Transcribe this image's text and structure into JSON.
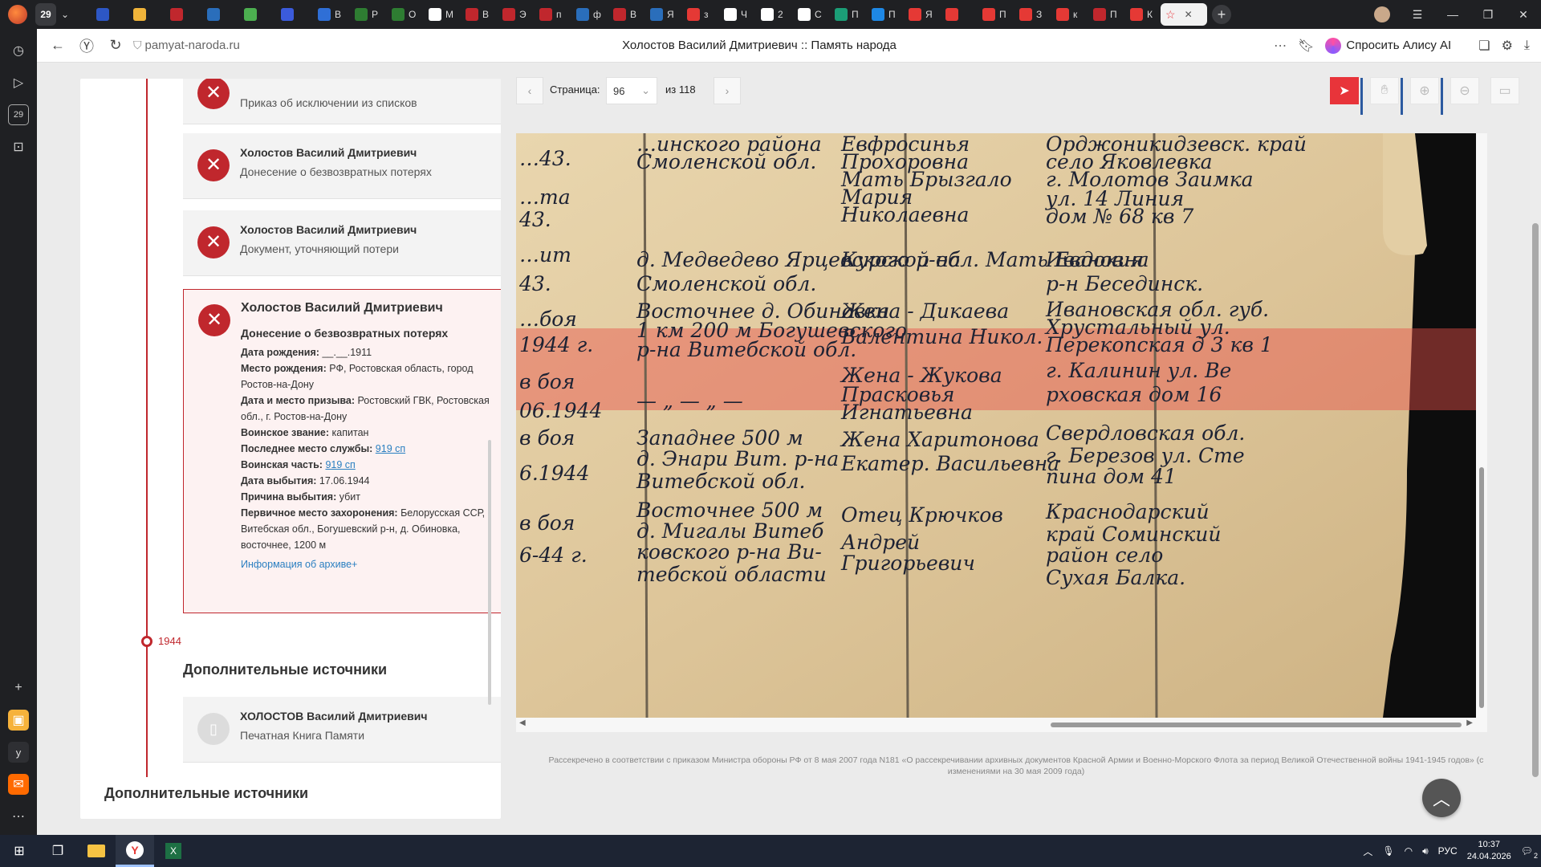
{
  "browser": {
    "tab_count": "29",
    "tabs": [
      {
        "label": "",
        "color": "#2d57c5"
      },
      {
        "label": "",
        "color": "#f0b43a"
      },
      {
        "label": "",
        "color": "#c0272d"
      },
      {
        "label": "",
        "color": "#2a6ebb"
      },
      {
        "label": "",
        "color": "#4caf50"
      },
      {
        "label": "",
        "color": "#3b5bdb"
      },
      {
        "label": "В",
        "color": "#2f6fd6"
      },
      {
        "label": "P",
        "color": "#2e7d32"
      },
      {
        "label": "O",
        "color": "#2e7d32"
      },
      {
        "label": "M",
        "color": "#ffffff"
      },
      {
        "label": "B",
        "color": "#c0272d"
      },
      {
        "label": "Э",
        "color": "#c0272d"
      },
      {
        "label": "п",
        "color": "#c0272d"
      },
      {
        "label": "ф",
        "color": "#2a6ebb"
      },
      {
        "label": "B",
        "color": "#c0272d"
      },
      {
        "label": "Я",
        "color": "#2a6ebb"
      },
      {
        "label": "з",
        "color": "#e53935"
      },
      {
        "label": "Ч",
        "color": "#ffffff"
      },
      {
        "label": "2",
        "color": "#ffffff"
      },
      {
        "label": "С",
        "color": "#ffffff"
      },
      {
        "label": "П",
        "color": "#1b9e77"
      },
      {
        "label": "П",
        "color": "#1e88e5"
      },
      {
        "label": "Я",
        "color": "#e53935"
      },
      {
        "label": "",
        "color": "#e53935"
      },
      {
        "label": "П",
        "color": "#e53935"
      },
      {
        "label": "З",
        "color": "#e53935"
      },
      {
        "label": "к",
        "color": "#e53935"
      },
      {
        "label": "П",
        "color": "#c0272d"
      },
      {
        "label": "К",
        "color": "#e53935"
      }
    ],
    "url": "pamyat-naroda.ru",
    "page_title": "Холостов Василий Дмитриевич :: Память народа",
    "ask_alice": "Спросить Алису AI",
    "sidebar_badge": "29"
  },
  "cards": [
    {
      "name": "",
      "subtitle": "Приказ об исключении из списков"
    },
    {
      "name": "Холостов Василий Дмитриевич",
      "subtitle": "Донесение о безвозвратных потерях"
    },
    {
      "name": "Холостов Василий Дмитриевич",
      "subtitle": "Документ, уточняющий потери"
    }
  ],
  "active_card": {
    "name": "Холостов Василий Дмитриевич",
    "doc_type": "Донесение о безвозвратных потерях",
    "fields": [
      {
        "label": "Дата рождения:",
        "value": "__.__.1911"
      },
      {
        "label": "Место рождения:",
        "value": "РФ, Ростовская область, город Ростов-на-Дону"
      },
      {
        "label": "Дата и место призыва:",
        "value": "Ростовский ГВК, Ростовская обл., г. Ростов-на-Дону"
      },
      {
        "label": "Воинское звание:",
        "value": "капитан"
      },
      {
        "label": "Последнее место службы:",
        "value": "919 сп"
      },
      {
        "label": "Воинская часть:",
        "value": "919 сп"
      },
      {
        "label": "Дата выбытия:",
        "value": "17.06.1944"
      },
      {
        "label": "Причина выбытия:",
        "value": "убит"
      },
      {
        "label": "Первичное место захоронения:",
        "value": "Белорусская ССР, Витебская обл., Богушевский р-н, д. Обиновка, восточнее, 1200 м"
      }
    ],
    "archive_link": "Информация об архиве+"
  },
  "timeline_year": "1944",
  "additional_sources_title": "Дополнительные источники",
  "extra_card": {
    "name": "ХОЛОСТОВ Василий Дмитриевич",
    "subtitle": "Печатная Книга Памяти"
  },
  "viewer": {
    "page_label": "Страница:",
    "page_value": "96",
    "of_label": "из 118"
  },
  "document_lines": {
    "col1": [
      "…инского района",
      "Смоленской обл.",
      "д. Медведево Ярцевского р-на",
      "Смоленской обл.",
      "Восточнее д. Обиновка",
      "1 км 200 м Богушевского",
      "р-на Витебской обл.",
      "— „ — „ —",
      "Западнее 500 м",
      "д. Энари Вит. р-на",
      "Витебской обл.",
      "Восточнее 500 м",
      "д. Мигалы Витеб",
      "ковского р-на Ви-",
      "тебской области"
    ],
    "col2": [
      "Евфросинья",
      "Прохоровна",
      "Мать Брызгало",
      "Мария",
      "Николаевна",
      "Курской обл. Мать Евдокия",
      "Жена - Дикаева",
      "Валентина Никол.",
      "Жена - Жукова",
      "Прасковья",
      "Игнатьевна",
      "Жена Харитонова",
      "Екатер. Васильевна",
      "Отец Крючков",
      "Андрей",
      "Григорьевич"
    ],
    "col3": [
      "Орджоникидзевск. край",
      "село Яковлевка",
      "г. Молотов Заимка",
      "ул. 14 Линия",
      "дом № 68 кв 7",
      "Ивановна",
      "р-н Бесединск.",
      "Ивановская обл. губ.",
      "Хрустальный ул.",
      "Перекопская д 3 кв 1",
      "г. Калинин ул. Ве",
      "рховская дом 16",
      "Свердловская обл.",
      "г. Березов ул. Сте",
      "пина дом 41",
      "Краснодарский",
      "край Соминский",
      "район село",
      "Сухая Балка."
    ],
    "margin": [
      "…43.",
      "…та",
      "43.",
      "…ит",
      "43.",
      "…боя",
      "1944 г.",
      "в боя",
      "06.1944",
      "в боя",
      "6.1944",
      "в боя",
      "6-44 г."
    ]
  },
  "declass_notice": "Рассекречено в соответствии с приказом Министра обороны РФ от 8 мая 2007 года N181 «О рассекречивании архивных документов Красной Армии и Военно-Морского Флота за период Великой Отечественной войны 1941-1945 годов» (с изменениями на 30 мая 2009 года)",
  "taskbar": {
    "lang": "РУС",
    "time": "10:37",
    "date": "24.04.2026",
    "notif": "2"
  },
  "colors": {
    "accent_red": "#c0272d",
    "link_blue": "#2a7fc1",
    "highlight": "#e8343a"
  }
}
